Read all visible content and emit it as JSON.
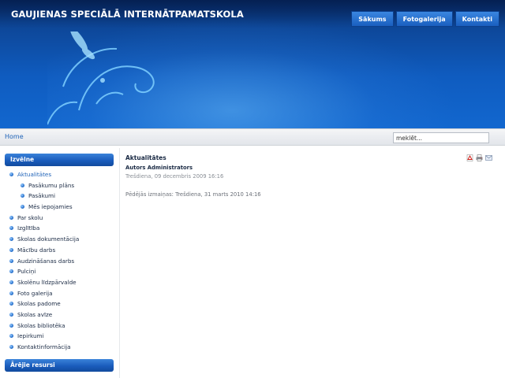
{
  "header": {
    "site_title": "GAUJIENAS SPECIĀLĀ INTERNĀTPAMATSKOLA",
    "nav": [
      "Sākums",
      "Fotogalerija",
      "Kontakti"
    ],
    "background_color": "#0f5cc0"
  },
  "breadcrumb": {
    "home": "Home"
  },
  "search": {
    "value": "meklēt..."
  },
  "sidebar": {
    "menu_heading": "Izvēlne",
    "items": [
      {
        "label": "Aktualitātes",
        "level": 1,
        "active": true
      },
      {
        "label": "Pasākumu plāns",
        "level": 2
      },
      {
        "label": "Pasākumi",
        "level": 2
      },
      {
        "label": "Mēs iepojamies",
        "level": 2
      },
      {
        "label": "Par skolu",
        "level": 1
      },
      {
        "label": "Izglītība",
        "level": 1
      },
      {
        "label": "Skolas dokumentācija",
        "level": 1
      },
      {
        "label": "Mācību darbs",
        "level": 1
      },
      {
        "label": "Audzināšanas darbs",
        "level": 1
      },
      {
        "label": "Pulciņi",
        "level": 1
      },
      {
        "label": "Skolēnu līdzpārvalde",
        "level": 1
      },
      {
        "label": "Foto galerija",
        "level": 1
      },
      {
        "label": "Skolas padome",
        "level": 1
      },
      {
        "label": "Skolas avīze",
        "level": 1
      },
      {
        "label": "Skolas bibliotēka",
        "level": 1
      },
      {
        "label": "Iepirkumi",
        "level": 1
      },
      {
        "label": "Kontaktinformācija",
        "level": 1
      }
    ],
    "external_heading": "Ārējie resursi"
  },
  "article": {
    "title": "Aktualitātes",
    "author": "Autors Administrators",
    "created": "Trešdiena, 09 decembris 2009 16:16",
    "modified": "Pēdējās izmaiņas: Trešdiena, 31 marts 2010 14:16",
    "icons": [
      "pdf-icon",
      "print-icon",
      "email-icon"
    ]
  },
  "colors": {
    "accent": "#1f63b8",
    "sidebar_head": "#1a5cbc"
  }
}
